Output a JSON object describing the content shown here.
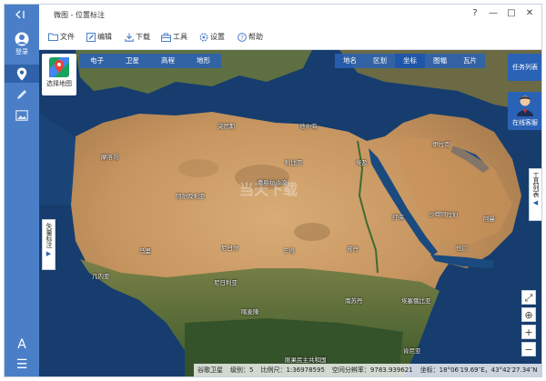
{
  "titlebar": {
    "title": "微图 - 位置标注",
    "controls": [
      "?",
      "—",
      "□",
      "✕"
    ]
  },
  "sidebar": {
    "collapse_icon": "collapse-left-icon",
    "login_label": "登录",
    "items": [
      {
        "name": "location-pin-icon"
      },
      {
        "name": "pen-icon"
      },
      {
        "name": "image-icon"
      }
    ],
    "bottom": [
      {
        "name": "font-style-icon",
        "glyph": "A"
      },
      {
        "name": "menu-icon",
        "glyph": "☰"
      }
    ]
  },
  "toolbar": {
    "items": [
      {
        "label": "文件",
        "icon": "folder-icon"
      },
      {
        "label": "编辑",
        "icon": "edit-icon"
      },
      {
        "label": "下载",
        "icon": "download-icon"
      },
      {
        "label": "工具",
        "icon": "toolbox-icon"
      },
      {
        "label": "设置",
        "icon": "gear-icon"
      },
      {
        "label": "帮助",
        "icon": "help-icon"
      }
    ]
  },
  "map": {
    "layer_select_label": "选择地图",
    "map_types": [
      "电子",
      "卫星",
      "高程",
      "地形"
    ],
    "overlays": [
      "地名",
      "区划",
      "坐标",
      "图幅",
      "瓦片"
    ],
    "active_overlay": "坐标",
    "task_list_label": "任务列表",
    "customer_service_label": "在线客服",
    "tools_tab_label": "工具列表",
    "vector_tab_label": "矢量标注",
    "zoom_controls": [
      {
        "name": "fullscreen-icon",
        "glyph": "⤢"
      },
      {
        "name": "locate-icon",
        "glyph": "⊕"
      },
      {
        "name": "zoom-in-button",
        "glyph": "+"
      },
      {
        "name": "zoom-out-button",
        "glyph": "−"
      }
    ],
    "watermark": "当天下载",
    "labels": [
      {
        "text": "地中海"
      },
      {
        "text": "撒哈拉沙漠"
      },
      {
        "text": "红海"
      },
      {
        "text": "伊拉克"
      },
      {
        "text": "沙特阿拉伯"
      },
      {
        "text": "阿尔及利亚"
      },
      {
        "text": "利比亚"
      },
      {
        "text": "埃及"
      },
      {
        "text": "马里"
      },
      {
        "text": "尼日尔"
      },
      {
        "text": "乍得"
      },
      {
        "text": "苏丹"
      },
      {
        "text": "几内亚"
      },
      {
        "text": "尼日利亚"
      },
      {
        "text": "喀麦隆"
      },
      {
        "text": "南苏丹"
      },
      {
        "text": "埃塞俄比亚"
      },
      {
        "text": "肯尼亚"
      },
      {
        "text": "刚果民主共和国"
      },
      {
        "text": "阿曼"
      },
      {
        "text": "也门"
      },
      {
        "text": "突尼斯"
      },
      {
        "text": "摩洛哥"
      }
    ]
  },
  "status": {
    "source": "谷歌卫星",
    "level": "级别：5",
    "scale": "比例尺：1:36978595",
    "resolution": "空间分辨率：9783.939621",
    "coords": "坐标：18°06′19.69″E，43°42′27.34″N"
  },
  "colors": {
    "sidebar": "#4a7fc8",
    "accent": "#2a62b6",
    "sea": "#143a6a",
    "desert": "#c99a64",
    "vegetation": "#4f6b34"
  }
}
